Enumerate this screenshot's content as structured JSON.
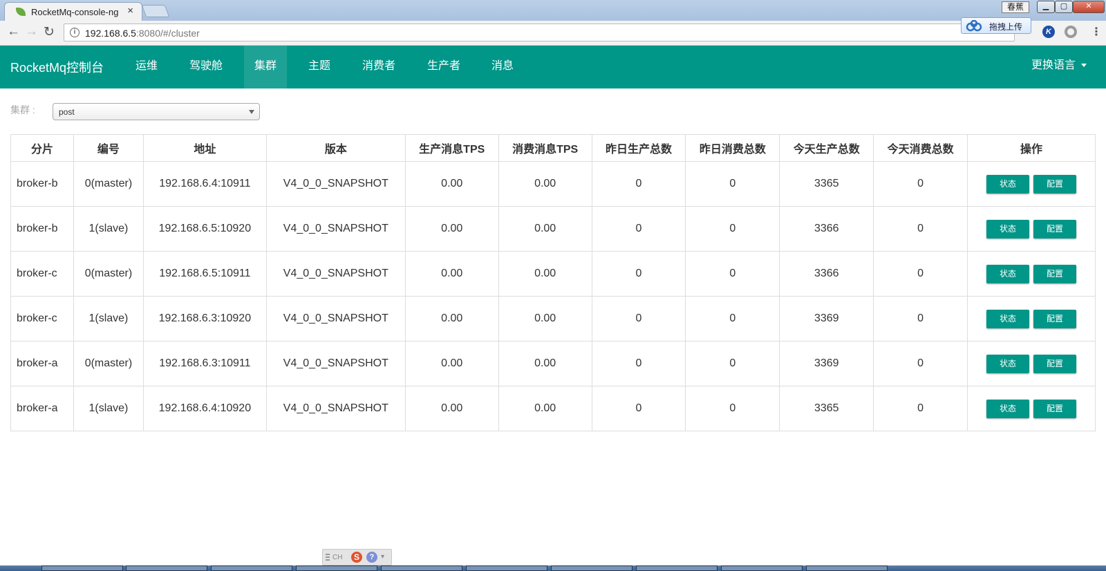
{
  "browser": {
    "tab_title": "RocketMq-console-ng",
    "tab_close": "×",
    "url_host": "192.168.6.5",
    "url_rest": ":8080/#/cluster",
    "ime_badge": "春蕉",
    "upload_label": "拖拽上传",
    "ext_k_label": "K"
  },
  "navbar": {
    "brand": "RocketMq控制台",
    "items": [
      {
        "label": "运维"
      },
      {
        "label": "驾驶舱"
      },
      {
        "label": "集群"
      },
      {
        "label": "主题"
      },
      {
        "label": "消费者"
      },
      {
        "label": "生产者"
      },
      {
        "label": "消息"
      }
    ],
    "active_item": "集群",
    "language": "更换语言"
  },
  "cluster_select": {
    "label": "集群 :",
    "value": "post"
  },
  "table": {
    "headers": [
      "分片",
      "编号",
      "地址",
      "版本",
      "生产消息TPS",
      "消费消息TPS",
      "昨日生产总数",
      "昨日消费总数",
      "今天生产总数",
      "今天消费总数",
      "操作"
    ],
    "status_label": "状态",
    "config_label": "配置",
    "rows": [
      {
        "broker": "broker-b",
        "no": "0(master)",
        "addr": "192.168.6.4:10911",
        "version": "V4_0_0_SNAPSHOT",
        "in_tps": "0.00",
        "out_tps": "0.00",
        "y_in": "0",
        "y_out": "0",
        "t_in": "3365",
        "t_out": "0"
      },
      {
        "broker": "broker-b",
        "no": "1(slave)",
        "addr": "192.168.6.5:10920",
        "version": "V4_0_0_SNAPSHOT",
        "in_tps": "0.00",
        "out_tps": "0.00",
        "y_in": "0",
        "y_out": "0",
        "t_in": "3366",
        "t_out": "0"
      },
      {
        "broker": "broker-c",
        "no": "0(master)",
        "addr": "192.168.6.5:10911",
        "version": "V4_0_0_SNAPSHOT",
        "in_tps": "0.00",
        "out_tps": "0.00",
        "y_in": "0",
        "y_out": "0",
        "t_in": "3366",
        "t_out": "0"
      },
      {
        "broker": "broker-c",
        "no": "1(slave)",
        "addr": "192.168.6.3:10920",
        "version": "V4_0_0_SNAPSHOT",
        "in_tps": "0.00",
        "out_tps": "0.00",
        "y_in": "0",
        "y_out": "0",
        "t_in": "3369",
        "t_out": "0"
      },
      {
        "broker": "broker-a",
        "no": "0(master)",
        "addr": "192.168.6.3:10911",
        "version": "V4_0_0_SNAPSHOT",
        "in_tps": "0.00",
        "out_tps": "0.00",
        "y_in": "0",
        "y_out": "0",
        "t_in": "3369",
        "t_out": "0"
      },
      {
        "broker": "broker-a",
        "no": "1(slave)",
        "addr": "192.168.6.4:10920",
        "version": "V4_0_0_SNAPSHOT",
        "in_tps": "0.00",
        "out_tps": "0.00",
        "y_in": "0",
        "y_out": "0",
        "t_in": "3365",
        "t_out": "0"
      }
    ]
  },
  "ime_toolbar": {
    "mode": "CH",
    "logo": "S",
    "help": "?"
  },
  "colors": {
    "accent": "#009688",
    "header_bg": "#009688",
    "button_bg": "#009688"
  }
}
